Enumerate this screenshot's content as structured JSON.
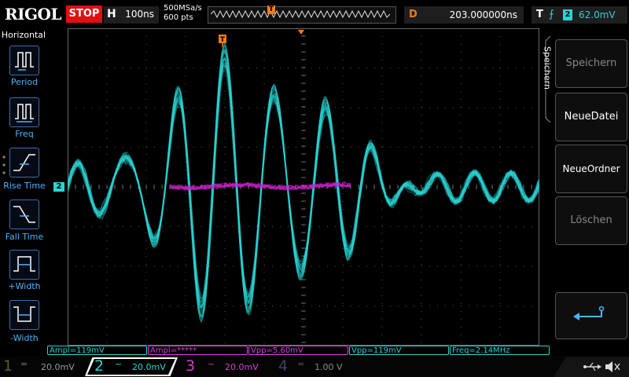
{
  "header": {
    "brand": "RIGOL",
    "run_state": "STOP",
    "timebase_label": "H",
    "timebase_value": "100ns",
    "sample_rate": "500MSa/s",
    "memory_depth": "600 pts",
    "trigger_marker": "T",
    "delay_label": "D",
    "delay_value": "203.000000ns",
    "trigger_label": "T",
    "trigger_edge": "rising-edge-icon",
    "trigger_source": "2",
    "trigger_level": "62.0mV"
  },
  "left_panel": {
    "title": "Horizontal",
    "items": [
      {
        "label": "Period",
        "icon": "period-icon"
      },
      {
        "label": "Freq",
        "icon": "freq-icon"
      },
      {
        "label": "Rise Time",
        "icon": "rise-time-icon"
      },
      {
        "label": "Fall Time",
        "icon": "fall-time-icon"
      },
      {
        "label": "+Width",
        "icon": "positive-width-icon"
      },
      {
        "label": "-Width",
        "icon": "negative-width-icon"
      }
    ]
  },
  "right_panel": {
    "title": "Speichern",
    "buttons": [
      {
        "label": "Speichern",
        "enabled": false
      },
      {
        "label": "NeueDatei",
        "enabled": true
      },
      {
        "label": "NeueOrdner",
        "enabled": true
      },
      {
        "label": "Löschen",
        "enabled": false
      }
    ],
    "back_icon": "return-arrow-icon"
  },
  "plot": {
    "ch2_marker": "2",
    "trigger_pos_marker": "T"
  },
  "measurements": [
    {
      "text": "Ampl=119mV",
      "color": "#2ad4d4"
    },
    {
      "text": "Ampl=*****",
      "color": "#e040e0"
    },
    {
      "text": "Vpp=5.60mV",
      "color": "#e040e0"
    },
    {
      "text": "Vpp=119mV",
      "color": "#2ad4d4"
    },
    {
      "text": "Freq=2.14MHz",
      "color": "#2ad4d4"
    }
  ],
  "channels": [
    {
      "num": "1",
      "coupling": "=",
      "scale": "20.0mV",
      "color": "#5a5a3a",
      "active": false
    },
    {
      "num": "2",
      "coupling": "~",
      "scale": "20.0mV",
      "color": "#2ad4d4",
      "active": true
    },
    {
      "num": "3",
      "coupling": "~",
      "scale": "20.0mV",
      "color": "#d040d0",
      "active": false
    },
    {
      "num": "4",
      "coupling": "=",
      "scale": "1.00 V",
      "color": "#404060",
      "active": false
    }
  ],
  "status_icons": [
    "usb-icon",
    "speaker-muted-icon"
  ],
  "colors": {
    "ch2": "#2ad4d4",
    "ch3": "#d020d0",
    "trigger": "#f07a1a"
  }
}
